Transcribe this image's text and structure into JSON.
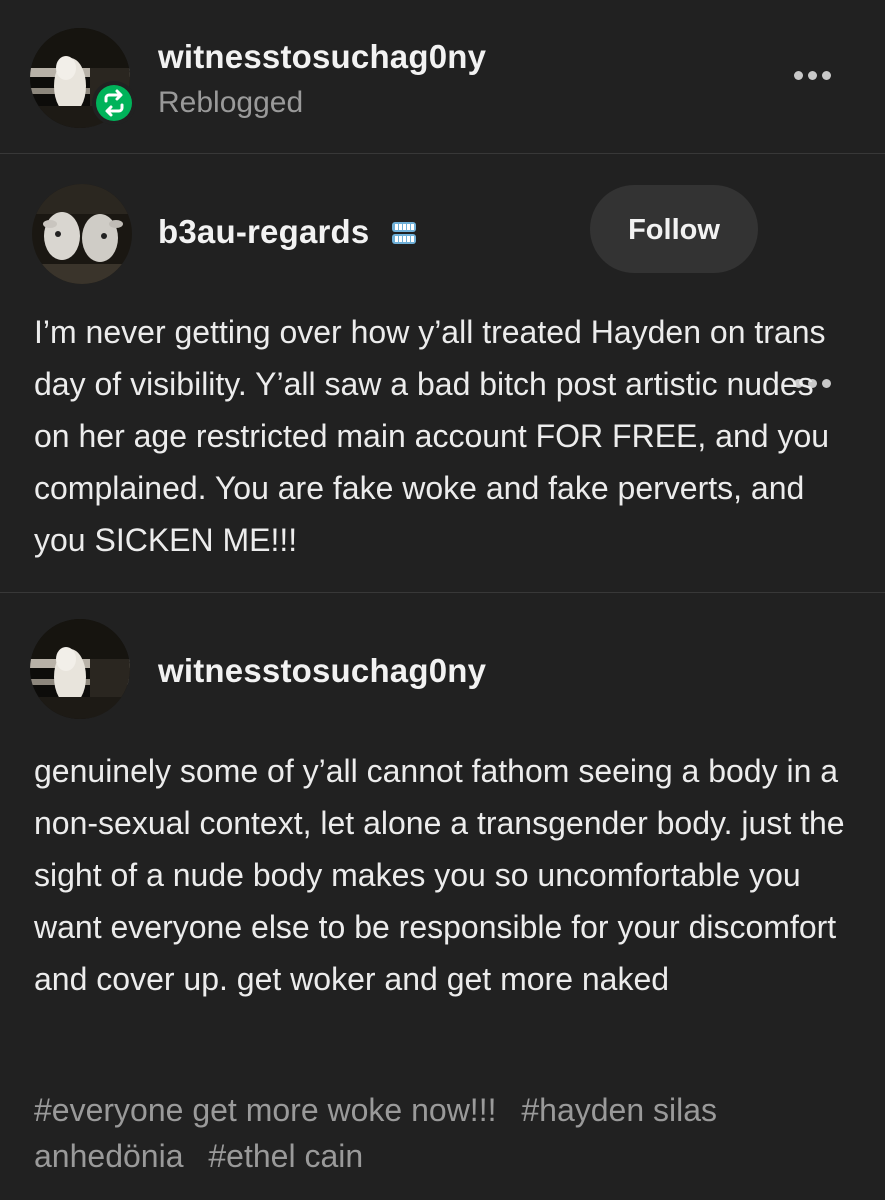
{
  "header": {
    "username": "witnesstosuchag0ny",
    "status": "Reblogged",
    "reblog_icon": "reblog-icon",
    "menu_icon": "more-dots-icon"
  },
  "trail": [
    {
      "username": "b3au-regards",
      "badge_icon": "dentures-badge-icon",
      "follow_label": "Follow",
      "body": "I’m never getting over how y’all treated Hayden on trans day of visibility. Y’all saw a bad bitch post artistic nudes on her age restricted main account FOR FREE, and you complained. You are fake woke and fake perverts, and you SICKEN ME!!!"
    },
    {
      "username": "witnesstosuchag0ny",
      "body": "genuinely some of y’all cannot fathom seeing a body in a non-sexual context, let alone a transgender body. just the sight of a nude body makes you so uncomfortable you want everyone else to be responsible for your discomfort and cover up. get woker and get more naked"
    }
  ],
  "tags": [
    "#everyone get more woke now!!!",
    "#hayden silas anhedönia",
    "#ethel cain"
  ],
  "colors": {
    "background": "#212121",
    "follow_button": "#333333",
    "reblog_green": "#00b35a",
    "muted_text": "#9a9a9a"
  }
}
